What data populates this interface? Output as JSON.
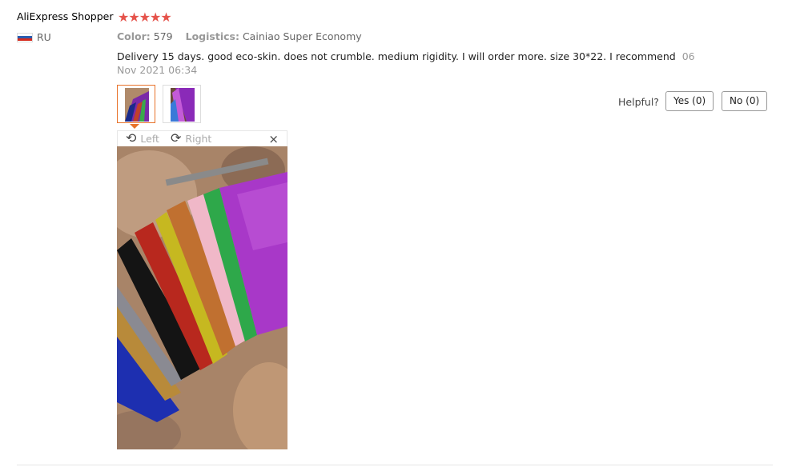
{
  "review": {
    "author": "AliExpress Shopper",
    "stars": "★★★★★",
    "rating": 5,
    "country_code": "RU",
    "attributes": {
      "color_label": "Color:",
      "color_value": "579",
      "logistics_label": "Logistics:",
      "logistics_value": "Cainiao Super Economy"
    },
    "text": "Delivery 15 days. good eco-skin. does not crumble. medium rigidity. I will order more. size 30*22. I recommend",
    "time": "06 Nov 2021 06:34"
  },
  "helpful": {
    "label": "Helpful?",
    "yes": "Yes (0)",
    "no": "No (0)"
  },
  "viewer": {
    "left": "Left",
    "right": "Right",
    "close": "×"
  },
  "colors": {
    "star": "#e5534b",
    "active_border": "#e8732b"
  }
}
